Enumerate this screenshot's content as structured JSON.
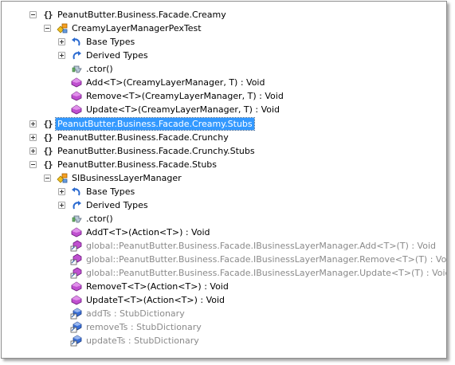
{
  "tree": {
    "ns_icon": "{}",
    "nodes": {
      "ns_creamy": {
        "label": "PeanutButter.Business.Facade.Creamy"
      },
      "class_pextest": {
        "label": "CreamyLayerManagerPexTest"
      },
      "base_types_1": {
        "label": "Base Types"
      },
      "derived_types_1": {
        "label": "Derived Types"
      },
      "ctor_1": {
        "label": ".ctor()"
      },
      "add_1": {
        "label": "Add<T>(CreamyLayerManager, T) : Void"
      },
      "remove_1": {
        "label": "Remove<T>(CreamyLayerManager, T) : Void"
      },
      "update_1": {
        "label": "Update<T>(CreamyLayerManager, T) : Void"
      },
      "ns_creamy_stubs": {
        "label": "PeanutButter.Business.Facade.Creamy.Stubs"
      },
      "ns_crunchy": {
        "label": "PeanutButter.Business.Facade.Crunchy"
      },
      "ns_crunchy_stubs": {
        "label": "PeanutButter.Business.Facade.Crunchy.Stubs"
      },
      "ns_stubs": {
        "label": "PeanutButter.Business.Facade.Stubs"
      },
      "class_si": {
        "label": "SIBusinessLayerManager"
      },
      "base_types_2": {
        "label": "Base Types"
      },
      "derived_types_2": {
        "label": "Derived Types"
      },
      "ctor_2": {
        "label": ".ctor()"
      },
      "addt": {
        "label": "AddT<T>(Action<T>) : Void"
      },
      "global_add": {
        "label": "global::PeanutButter.Business.Facade.IBusinessLayerManager.Add<T>(T) : Void"
      },
      "global_remove": {
        "label": "global::PeanutButter.Business.Facade.IBusinessLayerManager.Remove<T>(T) : Void"
      },
      "global_update": {
        "label": "global::PeanutButter.Business.Facade.IBusinessLayerManager.Update<T>(T) : Void"
      },
      "removet": {
        "label": "RemoveT<T>(Action<T>) : Void"
      },
      "updatet": {
        "label": "UpdateT<T>(Action<T>) : Void"
      },
      "addts": {
        "label": "addTs : StubDictionary"
      },
      "removets": {
        "label": "removeTs : StubDictionary"
      },
      "updatets": {
        "label": "updateTs : StubDictionary"
      }
    },
    "selected_node": "ns_creamy_stubs"
  },
  "colors": {
    "method_purple": "#b442c8",
    "field_blue": "#3a6fd6",
    "ctor_gray": "#7a8a9a",
    "selection_blue": "#3399ff",
    "gray_text": "#8a8a8a"
  },
  "icons": {
    "namespace": "braces-icon",
    "class": "class-icon",
    "base_types": "base-types-icon",
    "derived_types": "derived-types-icon",
    "ctor": "constructor-icon",
    "method": "method-icon",
    "explicit_method": "explicit-method-icon",
    "field": "field-icon"
  }
}
